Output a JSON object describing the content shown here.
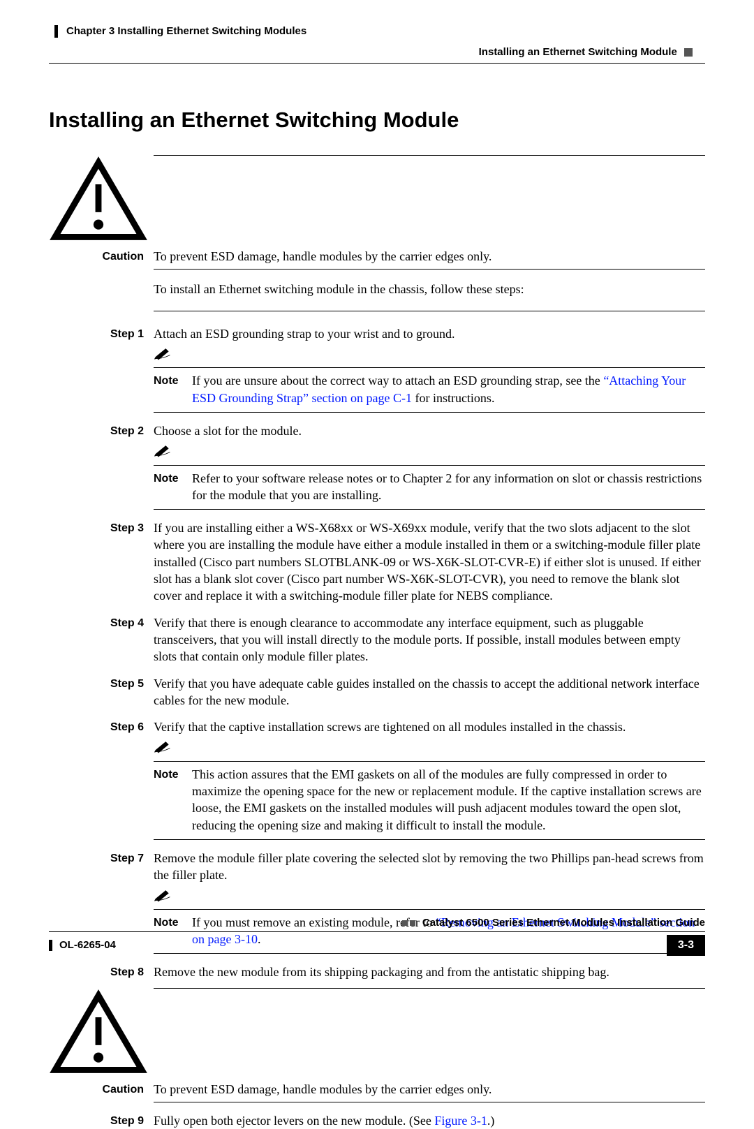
{
  "header": {
    "chapter": "Chapter 3      Installing Ethernet Switching Modules",
    "section": "Installing an Ethernet Switching Module"
  },
  "title": "Installing an Ethernet Switching Module",
  "caution_top": {
    "label": "Caution",
    "text": "To prevent ESD damage, handle modules by the carrier edges only."
  },
  "intro": "To install an Ethernet switching module in the chassis, follow these steps:",
  "steps": [
    {
      "label": "Step 1",
      "text": "Attach an ESD grounding strap to your wrist and to ground.",
      "note": {
        "label": "Note",
        "pre": "If you are unsure about the correct way to attach an ESD grounding strap, see the ",
        "link": "“Attaching Your ESD Grounding Strap” section on page C-1",
        "post": " for instructions."
      }
    },
    {
      "label": "Step 2",
      "text": "Choose a slot for the module.",
      "note": {
        "label": "Note",
        "pre": "Refer to your software release notes or to Chapter 2 for any information on slot or chassis restrictions for the module that you are installing.",
        "link": "",
        "post": ""
      }
    },
    {
      "label": "Step 3",
      "text": "If you are installing either a WS-X68xx or WS-X69xx module, verify that the two slots adjacent to the slot where you are installing the module have either a module installed in them or a switching-module filler plate installed (Cisco part numbers SLOTBLANK-09 or WS-X6K-SLOT-CVR-E) if either slot is unused. If either slot has a blank slot cover (Cisco part number WS-X6K-SLOT-CVR), you need to remove the blank slot cover and replace it with a switching-module filler plate for NEBS compliance."
    },
    {
      "label": "Step 4",
      "text": "Verify that there is enough clearance to accommodate any interface equipment, such as pluggable transceivers, that you will install directly to the module ports. If possible, install modules between empty slots that contain only module filler plates."
    },
    {
      "label": "Step 5",
      "text": "Verify that you have adequate cable guides installed on the chassis to accept the additional network interface cables for the new module."
    },
    {
      "label": "Step 6",
      "text": "Verify that the captive installation screws are tightened on all modules installed in the chassis.",
      "note": {
        "label": "Note",
        "pre": "This action assures that the EMI gaskets on all of the modules are fully compressed in order to maximize the opening space for the new or replacement module. If the captive installation screws are loose, the EMI gaskets on the installed modules will push adjacent modules toward the open slot, reducing the opening size and making it difficult to install the module.",
        "link": "",
        "post": ""
      }
    },
    {
      "label": "Step 7",
      "text": "Remove the module filler plate covering the selected slot by removing the two Phillips pan-head screws from the filler plate.",
      "note": {
        "label": "Note",
        "pre": "If you must remove an existing module, refer to ",
        "link": "“Removing an Ethernet Switching Module” section on page 3-10",
        "post": "."
      }
    },
    {
      "label": "Step 8",
      "text": "Remove the new module from its shipping packaging and from the antistatic shipping bag."
    }
  ],
  "caution_mid": {
    "label": "Caution",
    "text": "To prevent ESD damage, handle modules by the carrier edges only."
  },
  "step9": {
    "label": "Step 9",
    "pre": "Fully open both ejector levers on the new module. (See ",
    "link": "Figure 3-1",
    "post": ".)"
  },
  "footer": {
    "guide": "Catalyst 6500 Series Ethernet Modules Installation Guide",
    "doc": "OL-6265-04",
    "page": "3-3"
  }
}
